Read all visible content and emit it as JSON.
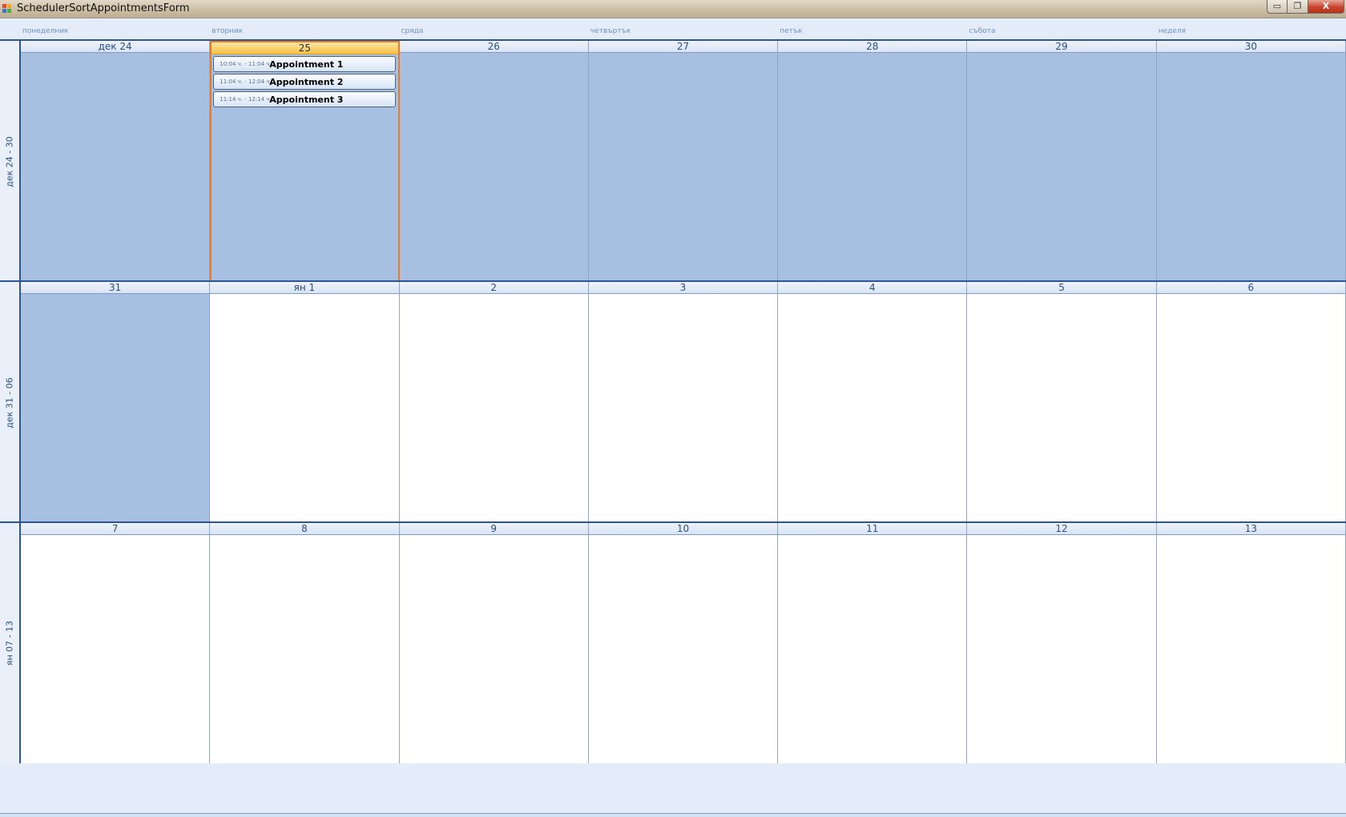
{
  "window": {
    "title": "SchedulerSortAppointmentsForm",
    "min_glyph": "▭",
    "max_glyph": "❐",
    "close_glyph": "X"
  },
  "colors": {
    "accent_selected": "#f07b1e",
    "shaded_cell": "#a7bfe0",
    "grid_line": "#2d5494"
  },
  "day_names": [
    "понеделник",
    "вторник",
    "сряда",
    "четвъртък",
    "петък",
    "събота",
    "неделя"
  ],
  "weeks": [
    {
      "label": "дек 24 - 30",
      "days": [
        {
          "header": "дек 24",
          "shaded": true
        },
        {
          "header": "25",
          "shaded": true,
          "selected": true,
          "appointments": [
            {
              "time": "10:04 ч. - 11:04 ч.",
              "subject": "Appointment 1"
            },
            {
              "time": "11:04 ч. - 12:04 ч.",
              "subject": "Appointment 2"
            },
            {
              "time": "11:14 ч. - 12:14 ч.",
              "subject": "Appointment 3"
            }
          ]
        },
        {
          "header": "26",
          "shaded": true
        },
        {
          "header": "27",
          "shaded": true
        },
        {
          "header": "28",
          "shaded": true
        },
        {
          "header": "29",
          "shaded": true
        },
        {
          "header": "30",
          "shaded": true
        }
      ]
    },
    {
      "label": "дек 31 - 06",
      "days": [
        {
          "header": "31",
          "shaded": true
        },
        {
          "header": "ян 1",
          "shaded": false
        },
        {
          "header": "2",
          "shaded": false
        },
        {
          "header": "3",
          "shaded": false
        },
        {
          "header": "4",
          "shaded": false
        },
        {
          "header": "5",
          "shaded": false
        },
        {
          "header": "6",
          "shaded": false
        }
      ]
    },
    {
      "label": "ян 07 - 13",
      "days": [
        {
          "header": "7",
          "shaded": false
        },
        {
          "header": "8",
          "shaded": false
        },
        {
          "header": "9",
          "shaded": false
        },
        {
          "header": "10",
          "shaded": false
        },
        {
          "header": "11",
          "shaded": false
        },
        {
          "header": "12",
          "shaded": false
        },
        {
          "header": "13",
          "shaded": false
        }
      ]
    }
  ]
}
